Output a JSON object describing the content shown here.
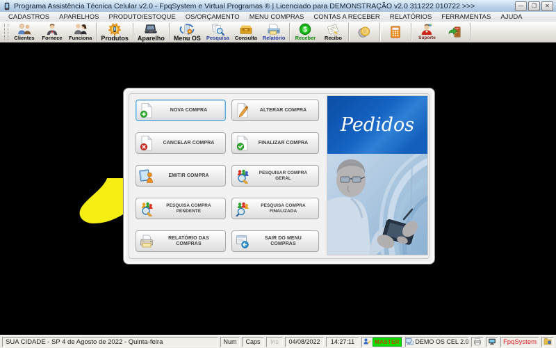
{
  "window": {
    "title": "Programa Assistência Técnica Celular v2.0 - FpqSystem e Virtual Programas ® | Licenciado para  DEMONSTRAÇÃO v2.0 311222 010722 >>>",
    "controls": {
      "minimize": "—",
      "maximize": "❐",
      "close": "✕"
    }
  },
  "menubar": {
    "items": [
      {
        "label": "CADASTROS"
      },
      {
        "label": "APARELHOS"
      },
      {
        "label": "PRODUTO/ESTOQUE"
      },
      {
        "label": "OS/ORÇAMENTO"
      },
      {
        "label": "MENU COMPRAS"
      },
      {
        "label": "CONTAS A RECEBER"
      },
      {
        "label": "RELATÓRIOS"
      },
      {
        "label": "FERRAMENTAS"
      },
      {
        "label": "AJUDA"
      }
    ]
  },
  "toolbar": {
    "items": [
      {
        "label": "Clientes"
      },
      {
        "label": "Fornece"
      },
      {
        "label": "Funciona"
      },
      {
        "label": "Produtos"
      },
      {
        "label": "Aparelho"
      },
      {
        "label": "Menu OS"
      },
      {
        "label": "Pesquisa"
      },
      {
        "label": "Consulta"
      },
      {
        "label": "Relatório"
      },
      {
        "label": "Receber"
      },
      {
        "label": "Recibo"
      },
      {
        "label": ""
      },
      {
        "label": ""
      },
      {
        "label": "Suporte"
      },
      {
        "label": ""
      }
    ]
  },
  "dialog": {
    "buttons": [
      {
        "label": "NOVA COMPRA"
      },
      {
        "label": "ALTERAR COMPRA"
      },
      {
        "label": "CANCELAR COMPRA"
      },
      {
        "label": "FINALIZAR COMPRA"
      },
      {
        "label": "EMITIR COMPRA"
      },
      {
        "label": "PESQUISAR COMPRA GERAL"
      },
      {
        "label": "PESQUISA COMPRA PENDENTE"
      },
      {
        "label": "PESQUISA COMPRA FINALIZADA"
      },
      {
        "label": "RELATÓRIO DAS COMPRAS"
      },
      {
        "label": "SAIR DO MENU COMPRAS"
      }
    ],
    "panel": {
      "title": "Pedidos"
    }
  },
  "statusbar": {
    "location": "SUA CIDADE - SP  4 de Agosto de 2022 - Quinta-feira",
    "num": "Num",
    "caps": "Caps",
    "ins": "Ins",
    "date": "04/08/2022",
    "time": "14:27:11",
    "user_level": "MASTER",
    "app_version": "DEMO OS CEL 2.0",
    "brand": "FpqSystem"
  },
  "colors": {
    "master_bg": "#00e400",
    "master_text": "#bc4408",
    "brand_text": "#e02020",
    "header_blue": "#1563c2",
    "blob_yellow": "#f6ee12"
  }
}
